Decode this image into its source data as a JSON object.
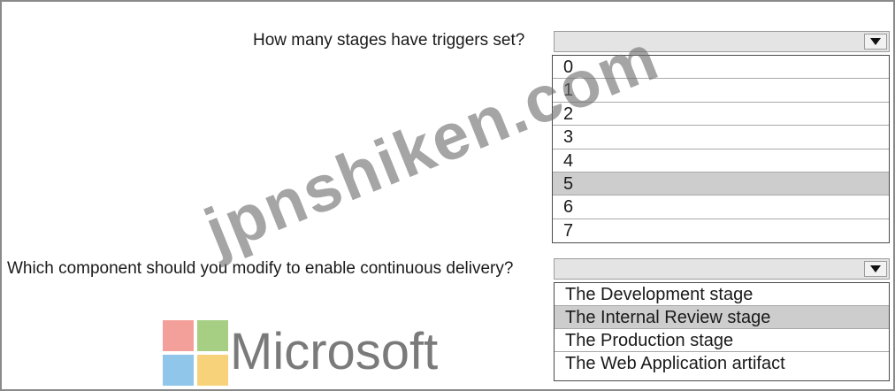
{
  "questions": [
    {
      "label": "How many stages have triggers set?",
      "selected_value": "",
      "options": [
        "0",
        "1",
        "2",
        "3",
        "4",
        "5",
        "6",
        "7"
      ],
      "highlighted_option": "5"
    },
    {
      "label": "Which component should you modify to enable continuous delivery?",
      "selected_value": "",
      "options": [
        "The Development stage",
        "The Internal Review stage",
        "The Production stage",
        "The Web Application artifact"
      ],
      "highlighted_option": "The Internal Review stage"
    }
  ],
  "branding": {
    "logo_text": "Microsoft",
    "logo_colors": [
      "#f25022",
      "#7fba00",
      "#00a4ef",
      "#ffb900"
    ]
  },
  "watermark": "jpnshiken.com"
}
